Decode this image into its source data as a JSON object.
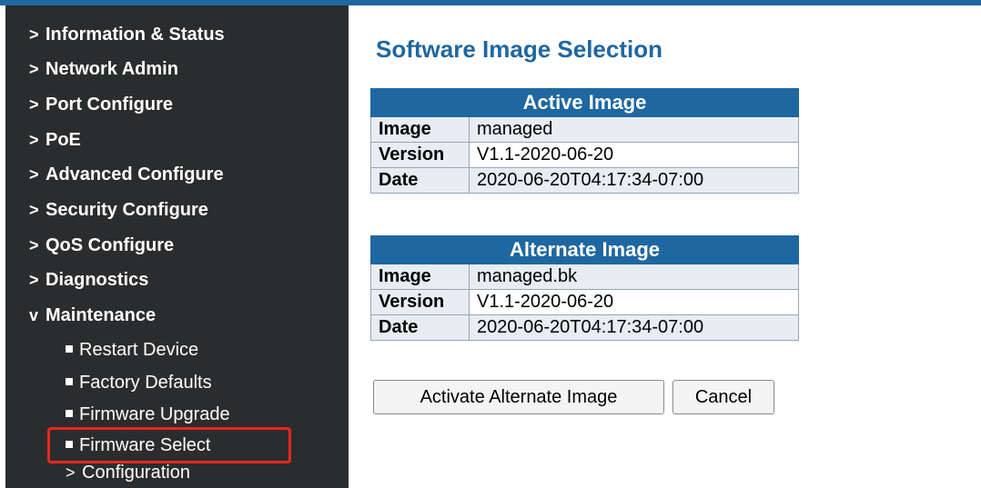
{
  "sidebar": {
    "items": [
      {
        "arrow": ">",
        "label": "Information & Status"
      },
      {
        "arrow": ">",
        "label": "Network Admin"
      },
      {
        "arrow": ">",
        "label": "Port Configure"
      },
      {
        "arrow": ">",
        "label": "PoE"
      },
      {
        "arrow": ">",
        "label": "Advanced Configure"
      },
      {
        "arrow": ">",
        "label": "Security Configure"
      },
      {
        "arrow": ">",
        "label": "QoS Configure"
      },
      {
        "arrow": ">",
        "label": "Diagnostics"
      },
      {
        "arrow": "v",
        "label": "Maintenance"
      }
    ],
    "maintenance_sub": [
      {
        "label": "Restart Device"
      },
      {
        "label": "Factory Defaults"
      },
      {
        "label": "Firmware Upgrade"
      },
      {
        "label": "Firmware Select"
      }
    ],
    "configuration": {
      "arrow": ">",
      "label": "Configuration"
    }
  },
  "main": {
    "title": "Software Image Selection",
    "active": {
      "header": "Active Image",
      "rows": [
        {
          "param": "Image",
          "value": "managed"
        },
        {
          "param": "Version",
          "value": "V1.1-2020-06-20"
        },
        {
          "param": "Date",
          "value": "2020-06-20T04:17:34-07:00"
        }
      ]
    },
    "alternate": {
      "header": "Alternate Image",
      "rows": [
        {
          "param": "Image",
          "value": "managed.bk"
        },
        {
          "param": "Version",
          "value": "V1.1-2020-06-20"
        },
        {
          "param": "Date",
          "value": "2020-06-20T04:17:34-07:00"
        }
      ]
    },
    "buttons": {
      "activate": "Activate Alternate Image",
      "cancel": "Cancel"
    }
  },
  "colors": {
    "sidebar_bg": "#2b2c2d",
    "accent": "#1f67a0",
    "highlight": "#e8271f"
  }
}
